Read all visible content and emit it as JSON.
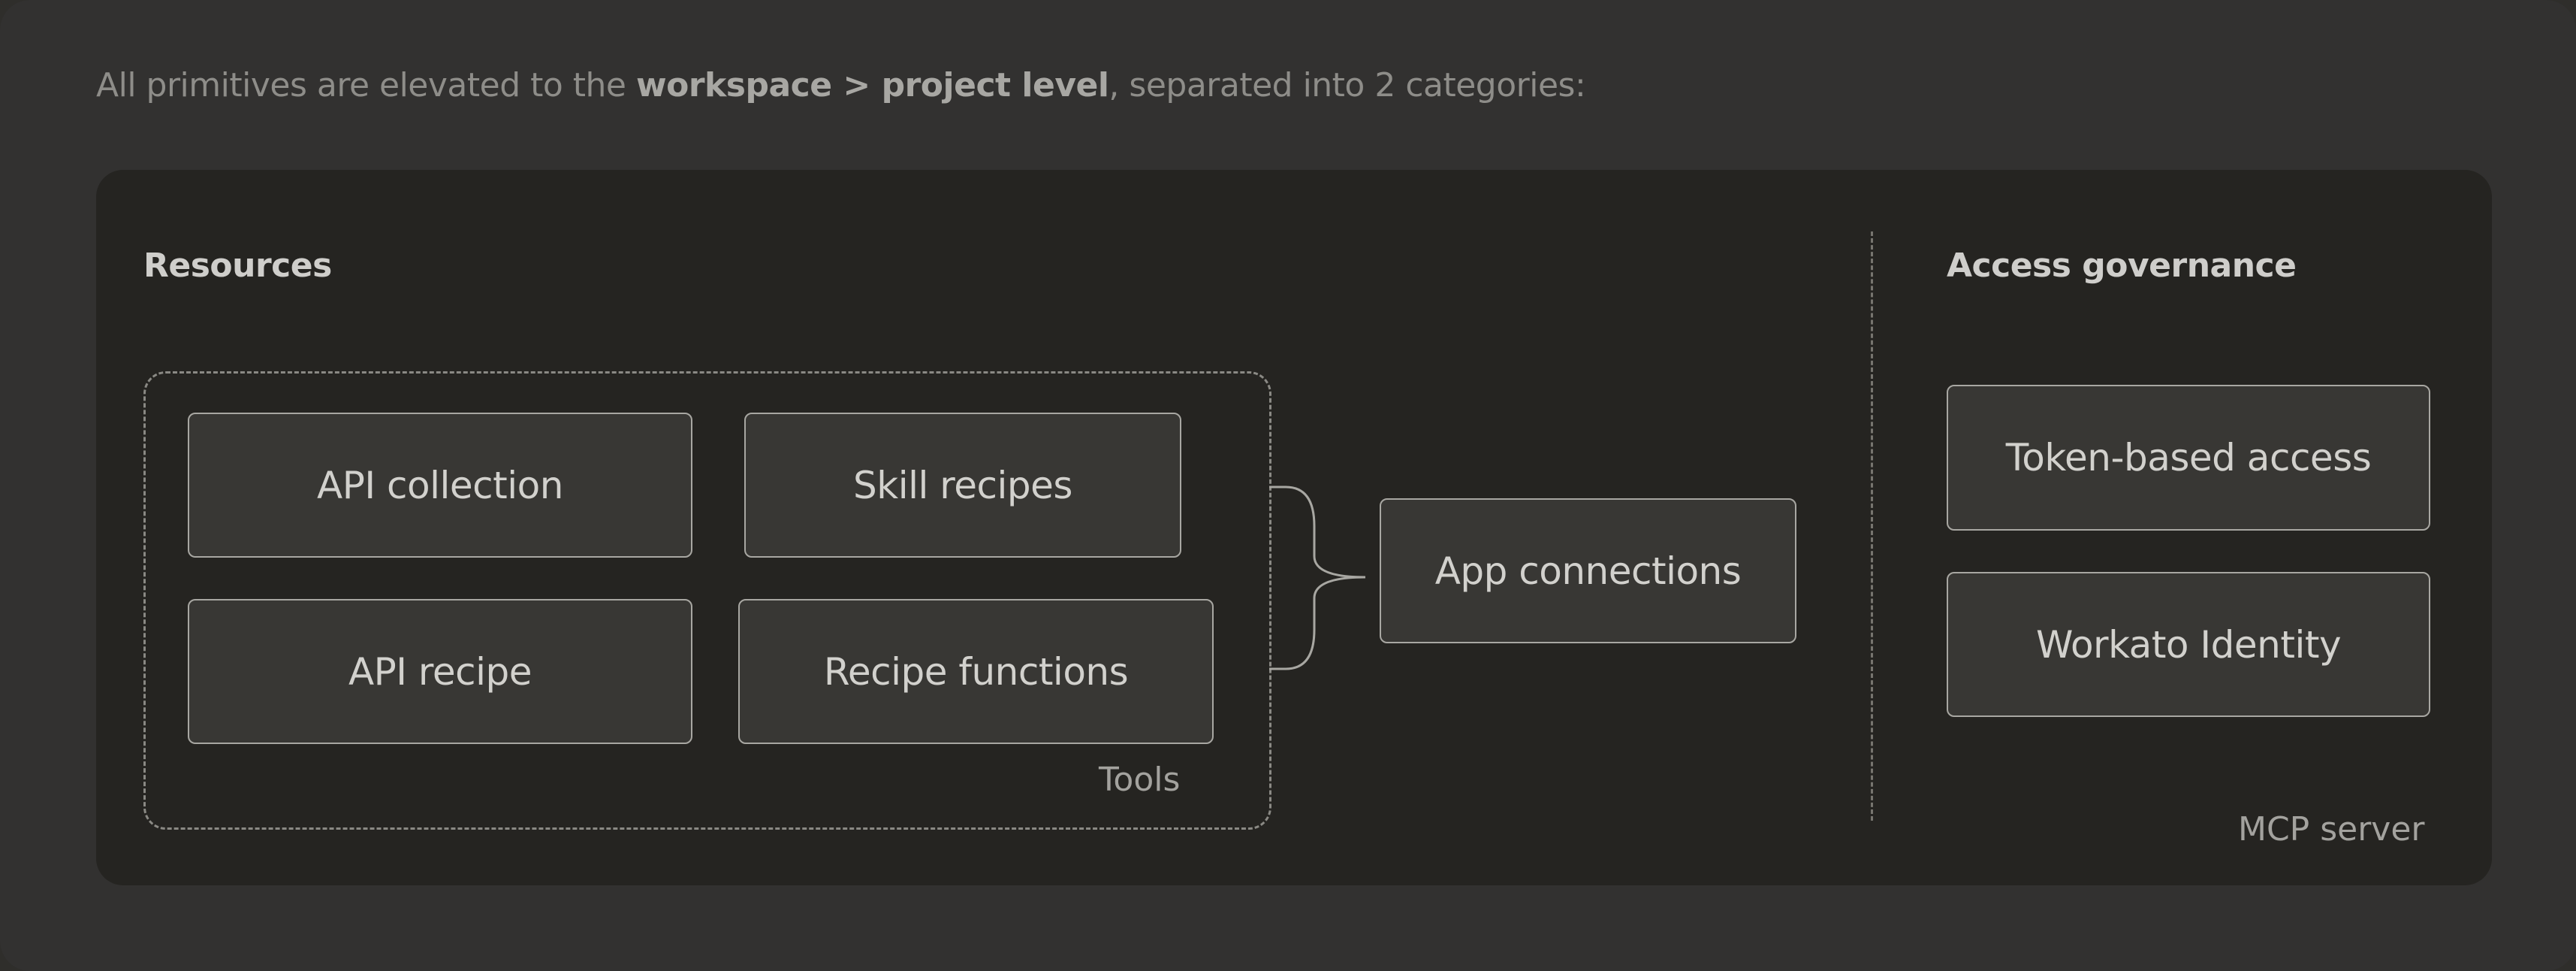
{
  "intro": {
    "prefix": "All primitives are elevated to the ",
    "emphasis": "workspace > project level",
    "suffix": ", separated into 2 categories:"
  },
  "resources": {
    "title": "Resources",
    "tools_label": "Tools",
    "tools": [
      {
        "label": "API collection"
      },
      {
        "label": "Skill recipes"
      },
      {
        "label": "API recipe"
      },
      {
        "label": "Recipe functions"
      }
    ],
    "app_connections": "App connections"
  },
  "access_governance": {
    "title": "Access governance",
    "items": [
      {
        "label": "Token-based access"
      },
      {
        "label": "Workato Identity"
      }
    ]
  },
  "server_label": "MCP server",
  "colors": {
    "background": "#323130",
    "panel": "#252421",
    "box": "#383734",
    "box_border": "#a8a7a2",
    "text": "#d2d1cd"
  }
}
